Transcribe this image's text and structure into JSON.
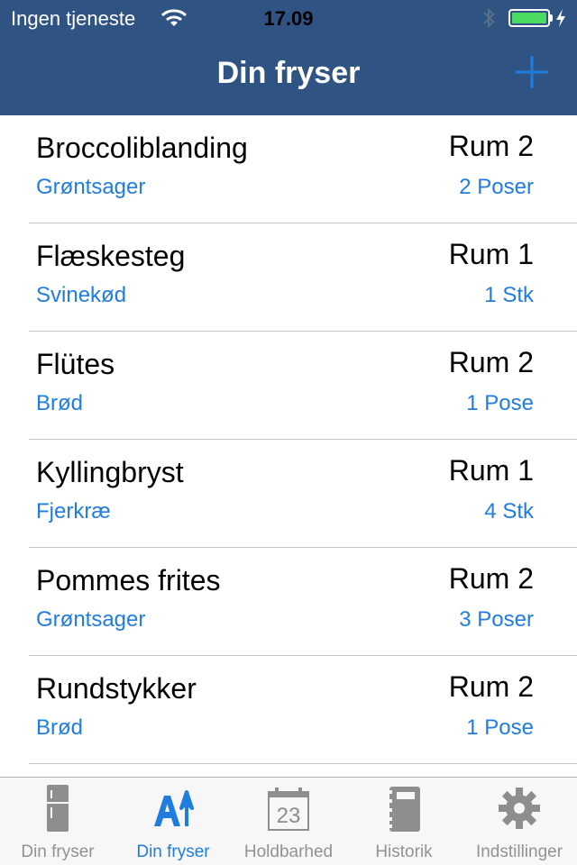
{
  "status_bar": {
    "carrier": "Ingen tjeneste",
    "time": "17.09"
  },
  "nav": {
    "title": "Din fryser",
    "add_icon": "plus-icon"
  },
  "items": [
    {
      "name": "Broccoliblanding",
      "category": "Grøntsager",
      "room": "Rum 2",
      "quantity": "2 Poser"
    },
    {
      "name": "Flæskesteg",
      "category": "Svinekød",
      "room": "Rum 1",
      "quantity": "1 Stk"
    },
    {
      "name": "Flütes",
      "category": "Brød",
      "room": "Rum 2",
      "quantity": "1 Pose"
    },
    {
      "name": "Kyllingbryst",
      "category": "Fjerkræ",
      "room": "Rum 1",
      "quantity": "4 Stk"
    },
    {
      "name": "Pommes frites",
      "category": "Grøntsager",
      "room": "Rum 2",
      "quantity": "3 Poser"
    },
    {
      "name": "Rundstykker",
      "category": "Brød",
      "room": "Rum 2",
      "quantity": "1 Pose"
    }
  ],
  "tabs": [
    {
      "label": "Din fryser",
      "icon": "fridge-icon",
      "active": false
    },
    {
      "label": "Din fryser",
      "icon": "sort-alpha-icon",
      "active": true
    },
    {
      "label": "Holdbarhed",
      "icon": "calendar-icon",
      "calendar_day": "23",
      "active": false
    },
    {
      "label": "Historik",
      "icon": "notebook-icon",
      "active": false
    },
    {
      "label": "Indstillinger",
      "icon": "gear-icon",
      "active": false
    }
  ],
  "colors": {
    "nav_bar": "#2f5382",
    "accent": "#1f7de0",
    "battery": "#4cd964",
    "tab_inactive": "#929292"
  }
}
